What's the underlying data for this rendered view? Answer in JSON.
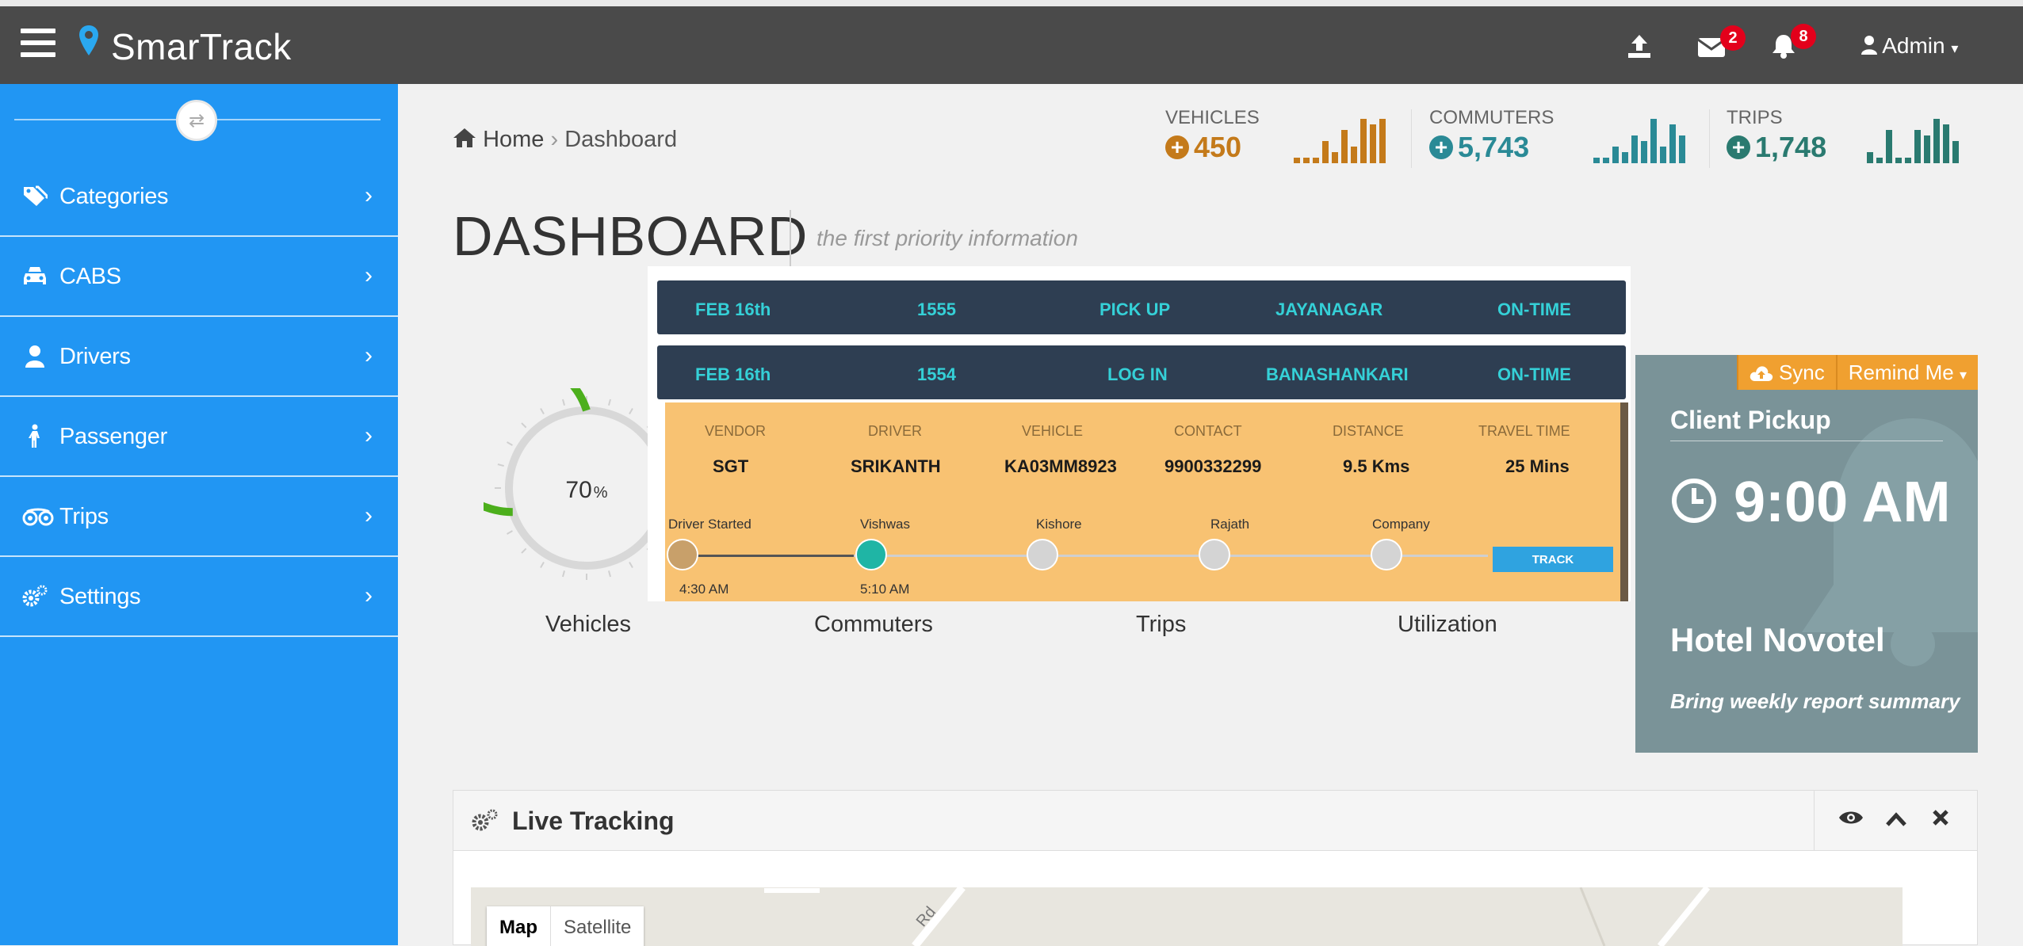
{
  "app": {
    "name": "SmarTrack",
    "user": "Admin"
  },
  "header": {
    "messages_count": "2",
    "alerts_count": "8"
  },
  "sidebar": {
    "items": [
      {
        "label": "Categories"
      },
      {
        "label": "CABS"
      },
      {
        "label": "Drivers"
      },
      {
        "label": "Passenger"
      },
      {
        "label": "Trips"
      },
      {
        "label": "Settings"
      }
    ]
  },
  "breadcrumb": {
    "home": "Home",
    "current": "Dashboard"
  },
  "stats": {
    "vehicles": {
      "label": "VEHICLES",
      "value": "450",
      "color": "#c47a1a",
      "spark": [
        1,
        1,
        1,
        4,
        2,
        6,
        3,
        8,
        7,
        8
      ]
    },
    "commuters": {
      "label": "COMMUTERS",
      "value": "5,743",
      "color": "#2a8a96",
      "spark": [
        1,
        1,
        3,
        2,
        5,
        4,
        8,
        3,
        7,
        5
      ]
    },
    "trips": {
      "label": "TRIPS",
      "value": "1,748",
      "color": "#2a7a70",
      "spark": [
        2,
        1,
        6,
        1,
        1,
        6,
        5,
        8,
        7,
        4
      ]
    }
  },
  "page": {
    "title": "DASHBOARD",
    "subtitle": "the first priority information"
  },
  "gauge": {
    "value_text": "70",
    "unit": "%",
    "fraction": 0.7
  },
  "gauge_labels": {
    "vehicles": "Vehicles",
    "commuters": "Commuters",
    "trips": "Trips",
    "utilization": "Utilization"
  },
  "trip_rows": [
    {
      "date": "FEB 16th",
      "id": "1555",
      "type": "PICK UP",
      "place": "JAYANAGAR",
      "status": "ON-TIME"
    },
    {
      "date": "FEB 16th",
      "id": "1554",
      "type": "LOG IN",
      "place": "BANASHANKARI",
      "status": "ON-TIME"
    }
  ],
  "trip_detail": {
    "headers": [
      "VENDOR",
      "DRIVER",
      "VEHICLE",
      "CONTACT",
      "DISTANCE",
      "TRAVEL TIME"
    ],
    "values": [
      "SGT",
      "SRIKANTH",
      "KA03MM8923",
      "9900332299",
      "9.5 Kms",
      "25 Mins"
    ],
    "steps": [
      {
        "name": "Driver Started",
        "time": "4:30 AM",
        "color": "#c8a06a"
      },
      {
        "name": "Vishwas",
        "time": "5:10 AM",
        "color": "#1fb5a5"
      },
      {
        "name": "Kishore",
        "time": "",
        "color": "#d4d4d4"
      },
      {
        "name": "Rajath",
        "time": "",
        "color": "#d4d4d4"
      },
      {
        "name": "Company",
        "time": "",
        "color": "#d4d4d4"
      }
    ],
    "track_label": "TRACK"
  },
  "pickup": {
    "sync_label": "Sync",
    "remind_label": "Remind Me",
    "title": "Client Pickup",
    "time": "9:00 AM",
    "location": "Hotel Novotel",
    "note": "Bring weekly report summary"
  },
  "live": {
    "title": "Live Tracking",
    "map_label": "Map",
    "satellite_label": "Satellite",
    "road_label": "Rd"
  }
}
